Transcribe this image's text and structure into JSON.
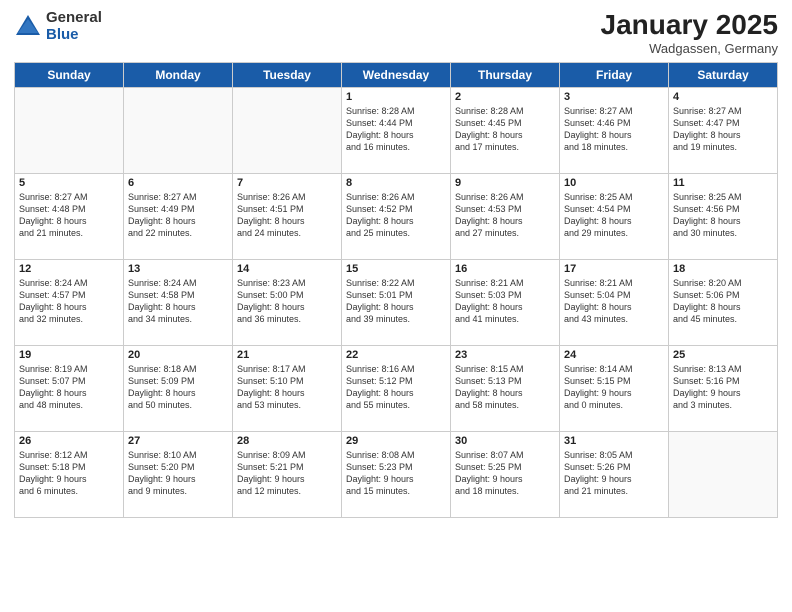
{
  "header": {
    "logo_general": "General",
    "logo_blue": "Blue",
    "month_title": "January 2025",
    "location": "Wadgassen, Germany"
  },
  "days_of_week": [
    "Sunday",
    "Monday",
    "Tuesday",
    "Wednesday",
    "Thursday",
    "Friday",
    "Saturday"
  ],
  "weeks": [
    [
      {
        "day": "",
        "info": ""
      },
      {
        "day": "",
        "info": ""
      },
      {
        "day": "",
        "info": ""
      },
      {
        "day": "1",
        "info": "Sunrise: 8:28 AM\nSunset: 4:44 PM\nDaylight: 8 hours\nand 16 minutes."
      },
      {
        "day": "2",
        "info": "Sunrise: 8:28 AM\nSunset: 4:45 PM\nDaylight: 8 hours\nand 17 minutes."
      },
      {
        "day": "3",
        "info": "Sunrise: 8:27 AM\nSunset: 4:46 PM\nDaylight: 8 hours\nand 18 minutes."
      },
      {
        "day": "4",
        "info": "Sunrise: 8:27 AM\nSunset: 4:47 PM\nDaylight: 8 hours\nand 19 minutes."
      }
    ],
    [
      {
        "day": "5",
        "info": "Sunrise: 8:27 AM\nSunset: 4:48 PM\nDaylight: 8 hours\nand 21 minutes."
      },
      {
        "day": "6",
        "info": "Sunrise: 8:27 AM\nSunset: 4:49 PM\nDaylight: 8 hours\nand 22 minutes."
      },
      {
        "day": "7",
        "info": "Sunrise: 8:26 AM\nSunset: 4:51 PM\nDaylight: 8 hours\nand 24 minutes."
      },
      {
        "day": "8",
        "info": "Sunrise: 8:26 AM\nSunset: 4:52 PM\nDaylight: 8 hours\nand 25 minutes."
      },
      {
        "day": "9",
        "info": "Sunrise: 8:26 AM\nSunset: 4:53 PM\nDaylight: 8 hours\nand 27 minutes."
      },
      {
        "day": "10",
        "info": "Sunrise: 8:25 AM\nSunset: 4:54 PM\nDaylight: 8 hours\nand 29 minutes."
      },
      {
        "day": "11",
        "info": "Sunrise: 8:25 AM\nSunset: 4:56 PM\nDaylight: 8 hours\nand 30 minutes."
      }
    ],
    [
      {
        "day": "12",
        "info": "Sunrise: 8:24 AM\nSunset: 4:57 PM\nDaylight: 8 hours\nand 32 minutes."
      },
      {
        "day": "13",
        "info": "Sunrise: 8:24 AM\nSunset: 4:58 PM\nDaylight: 8 hours\nand 34 minutes."
      },
      {
        "day": "14",
        "info": "Sunrise: 8:23 AM\nSunset: 5:00 PM\nDaylight: 8 hours\nand 36 minutes."
      },
      {
        "day": "15",
        "info": "Sunrise: 8:22 AM\nSunset: 5:01 PM\nDaylight: 8 hours\nand 39 minutes."
      },
      {
        "day": "16",
        "info": "Sunrise: 8:21 AM\nSunset: 5:03 PM\nDaylight: 8 hours\nand 41 minutes."
      },
      {
        "day": "17",
        "info": "Sunrise: 8:21 AM\nSunset: 5:04 PM\nDaylight: 8 hours\nand 43 minutes."
      },
      {
        "day": "18",
        "info": "Sunrise: 8:20 AM\nSunset: 5:06 PM\nDaylight: 8 hours\nand 45 minutes."
      }
    ],
    [
      {
        "day": "19",
        "info": "Sunrise: 8:19 AM\nSunset: 5:07 PM\nDaylight: 8 hours\nand 48 minutes."
      },
      {
        "day": "20",
        "info": "Sunrise: 8:18 AM\nSunset: 5:09 PM\nDaylight: 8 hours\nand 50 minutes."
      },
      {
        "day": "21",
        "info": "Sunrise: 8:17 AM\nSunset: 5:10 PM\nDaylight: 8 hours\nand 53 minutes."
      },
      {
        "day": "22",
        "info": "Sunrise: 8:16 AM\nSunset: 5:12 PM\nDaylight: 8 hours\nand 55 minutes."
      },
      {
        "day": "23",
        "info": "Sunrise: 8:15 AM\nSunset: 5:13 PM\nDaylight: 8 hours\nand 58 minutes."
      },
      {
        "day": "24",
        "info": "Sunrise: 8:14 AM\nSunset: 5:15 PM\nDaylight: 9 hours\nand 0 minutes."
      },
      {
        "day": "25",
        "info": "Sunrise: 8:13 AM\nSunset: 5:16 PM\nDaylight: 9 hours\nand 3 minutes."
      }
    ],
    [
      {
        "day": "26",
        "info": "Sunrise: 8:12 AM\nSunset: 5:18 PM\nDaylight: 9 hours\nand 6 minutes."
      },
      {
        "day": "27",
        "info": "Sunrise: 8:10 AM\nSunset: 5:20 PM\nDaylight: 9 hours\nand 9 minutes."
      },
      {
        "day": "28",
        "info": "Sunrise: 8:09 AM\nSunset: 5:21 PM\nDaylight: 9 hours\nand 12 minutes."
      },
      {
        "day": "29",
        "info": "Sunrise: 8:08 AM\nSunset: 5:23 PM\nDaylight: 9 hours\nand 15 minutes."
      },
      {
        "day": "30",
        "info": "Sunrise: 8:07 AM\nSunset: 5:25 PM\nDaylight: 9 hours\nand 18 minutes."
      },
      {
        "day": "31",
        "info": "Sunrise: 8:05 AM\nSunset: 5:26 PM\nDaylight: 9 hours\nand 21 minutes."
      },
      {
        "day": "",
        "info": ""
      }
    ]
  ]
}
